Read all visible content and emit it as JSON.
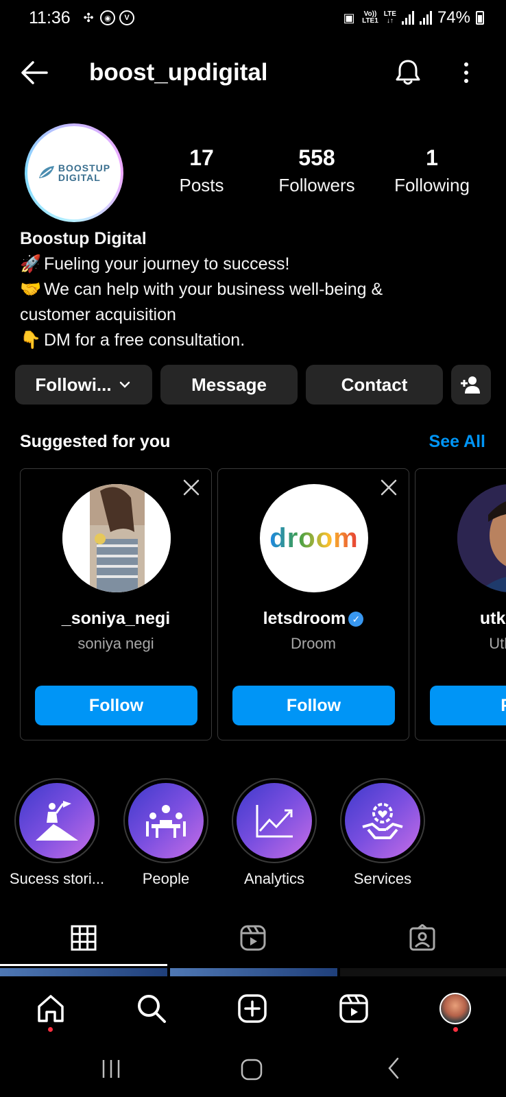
{
  "status_bar": {
    "time": "11:36",
    "network_top": "Vo))",
    "network_bottom": "LTE1",
    "lte": "LTE",
    "battery": "74%"
  },
  "header": {
    "username": "boost_updigital"
  },
  "profile": {
    "logo_line1": "BOOSTUP",
    "logo_line2": "DIGITAL",
    "stats": [
      {
        "num": "17",
        "label": "Posts"
      },
      {
        "num": "558",
        "label": "Followers"
      },
      {
        "num": "1",
        "label": "Following"
      }
    ],
    "name": "Boostup Digital",
    "bio_lines": [
      {
        "emoji": "🚀",
        "text": "Fueling your journey to success!"
      },
      {
        "emoji": "🤝",
        "text": "We can help with your business well-being &"
      },
      {
        "emoji": "",
        "text": "customer acquisition"
      },
      {
        "emoji": "👇",
        "text": "DM for a free consultation."
      }
    ]
  },
  "actions": {
    "following": "Followi...",
    "message": "Message",
    "contact": "Contact"
  },
  "suggested": {
    "title": "Suggested for you",
    "see_all": "See All",
    "cards": [
      {
        "username": "_soniya_negi",
        "name": "soniya negi",
        "follow": "Follow"
      },
      {
        "username": "letsdroom",
        "name": "Droom",
        "follow": "Follow",
        "logo": "droom"
      },
      {
        "username": "utkarsh",
        "name": "Utkars",
        "follow": "Fo"
      }
    ]
  },
  "highlights": [
    {
      "label": "Sucess stori..."
    },
    {
      "label": "People"
    },
    {
      "label": "Analytics"
    },
    {
      "label": "Services"
    }
  ],
  "colors": {
    "accent": "#0095f6",
    "button_bg": "#262626",
    "notification_dot": "#ff3040"
  }
}
